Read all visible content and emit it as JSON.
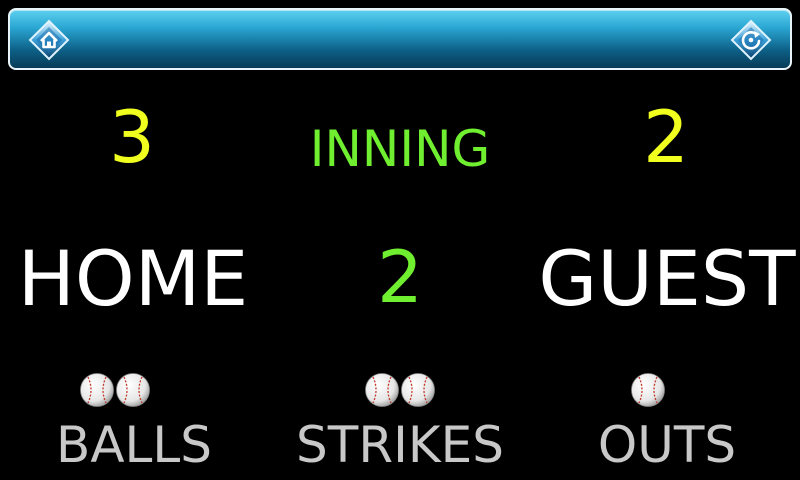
{
  "topbar": {
    "left_icon": "home-icon",
    "right_icon": "reset-icon",
    "accent": "#2aa7d3"
  },
  "scoreboard": {
    "home_score": "3",
    "guest_score": "2",
    "inning_label": "INNING",
    "inning_value": "2",
    "home_label": "HOME",
    "guest_label": "GUEST"
  },
  "counts": {
    "balls": {
      "label": "BALLS",
      "value": 2,
      "icon": "baseball-icon"
    },
    "strikes": {
      "label": "STRIKES",
      "value": 2,
      "icon": "baseball-icon"
    },
    "outs": {
      "label": "OUTS",
      "value": 1,
      "icon": "baseball-icon"
    }
  },
  "colors": {
    "background": "#000000",
    "score": "#f0ff1e",
    "inning": "#6fef2f",
    "team": "#ffffff",
    "count_label": "#c8c8c8"
  }
}
